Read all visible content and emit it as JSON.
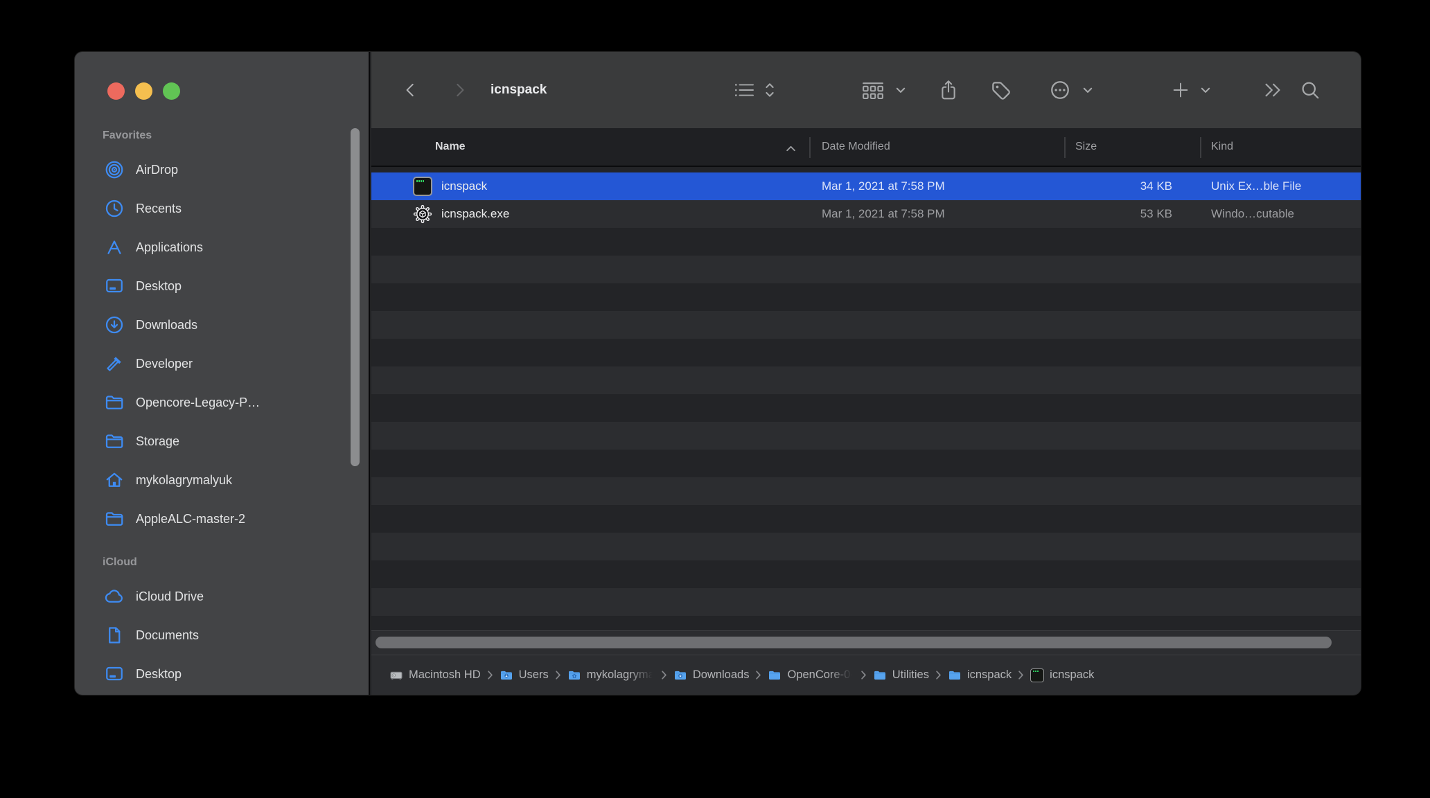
{
  "colors": {
    "selection_blue": "#2457d5",
    "sidebar_icon_blue": "#3e8bf2",
    "traffic_red": "#ed6a5e",
    "traffic_yellow": "#f5bf4f",
    "traffic_green": "#61c454"
  },
  "window": {
    "title": "icnspack",
    "toolbar_icons": [
      "back",
      "forward",
      "list-view",
      "sort-chevrons",
      "group-grid",
      "group-chevron",
      "share",
      "tags",
      "more-actions",
      "more-actions-chevron",
      "add",
      "add-chevron",
      "toolbar-overflow",
      "search"
    ]
  },
  "sidebar": {
    "sections": [
      {
        "title": "Favorites",
        "items": [
          {
            "label": "AirDrop",
            "icon": "airdrop"
          },
          {
            "label": "Recents",
            "icon": "clock"
          },
          {
            "label": "Applications",
            "icon": "app-a"
          },
          {
            "label": "Desktop",
            "icon": "desktop"
          },
          {
            "label": "Downloads",
            "icon": "download-circle"
          },
          {
            "label": "Developer",
            "icon": "hammer"
          },
          {
            "label": "Opencore-Legacy-P…",
            "icon": "folder"
          },
          {
            "label": "Storage",
            "icon": "folder"
          },
          {
            "label": "mykolagrymalyuk",
            "icon": "home"
          },
          {
            "label": "AppleALC-master-2",
            "icon": "folder"
          }
        ]
      },
      {
        "title": "iCloud",
        "items": [
          {
            "label": "iCloud Drive",
            "icon": "cloud"
          },
          {
            "label": "Documents",
            "icon": "document"
          },
          {
            "label": "Desktop",
            "icon": "desktop"
          }
        ]
      }
    ]
  },
  "list": {
    "columns": {
      "name": "Name",
      "date": "Date Modified",
      "size": "Size",
      "kind": "Kind"
    },
    "sort_column": "Name",
    "files": [
      {
        "name": "icnspack",
        "icon": "unix-executable",
        "date_modified": "Mar 1, 2021 at 7:58 PM",
        "size": "34 KB",
        "kind": "Unix Ex…ble File",
        "selected": true
      },
      {
        "name": "icnspack.exe",
        "icon": "windows-executable",
        "date_modified": "Mar 1, 2021 at 7:58 PM",
        "size": "53 KB",
        "kind": "Windo…cutable",
        "selected": false
      }
    ]
  },
  "path_bar": {
    "items": [
      {
        "label": "Macintosh HD",
        "icon": "hard-drive",
        "truncated": false
      },
      {
        "label": "Users",
        "icon": "folder-user",
        "truncated": false
      },
      {
        "label": "mykolagryma",
        "icon": "folder-home",
        "truncated": true
      },
      {
        "label": "Downloads",
        "icon": "folder-download",
        "truncated": false
      },
      {
        "label": "OpenCore-0-",
        "icon": "folder",
        "truncated": true
      },
      {
        "label": "Utilities",
        "icon": "folder",
        "truncated": false
      },
      {
        "label": "icnspack",
        "icon": "folder",
        "truncated": false
      },
      {
        "label": "icnspack",
        "icon": "unix-executable",
        "truncated": false
      }
    ]
  }
}
